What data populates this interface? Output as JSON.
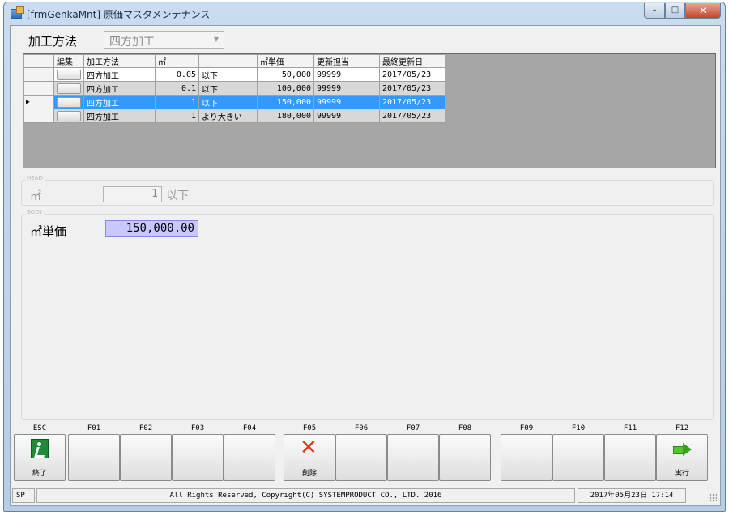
{
  "window": {
    "title": "[frmGenkaMnt] 原価マスタメンテナンス",
    "controls": {
      "minimize": "–",
      "maximize": "□",
      "close": "✕"
    }
  },
  "filter": {
    "label": "加工方法",
    "value": "四方加工"
  },
  "grid": {
    "columns": [
      "",
      "編集",
      "加工方法",
      "㎡",
      "",
      "㎡単価",
      "更新担当",
      "最終更新日"
    ],
    "rows": [
      {
        "method": "四方加工",
        "m2": "0.05",
        "cond": "以下",
        "unit_price": "50,000",
        "updater": "99999",
        "updated": "2017/05/23",
        "style": "white",
        "selected": false
      },
      {
        "method": "四方加工",
        "m2": "0.1",
        "cond": "以下",
        "unit_price": "100,000",
        "updater": "99999",
        "updated": "2017/05/23",
        "style": "gray",
        "selected": false
      },
      {
        "method": "四方加工",
        "m2": "1",
        "cond": "以下",
        "unit_price": "150,000",
        "updater": "99999",
        "updated": "2017/05/23",
        "style": "sel",
        "selected": true
      },
      {
        "method": "四方加工",
        "m2": "1",
        "cond": "より大きい",
        "unit_price": "180,000",
        "updater": "99999",
        "updated": "2017/05/23",
        "style": "gray",
        "selected": false
      }
    ],
    "current_row_marker": "▶"
  },
  "head": {
    "group_title": "HEAD",
    "m2_label": "㎡",
    "m2_value": "1",
    "m2_unit": "以下"
  },
  "body": {
    "group_title": "BODY",
    "unit_price_label": "㎡単価",
    "unit_price_value": "150,000.00"
  },
  "fkeys": [
    {
      "key": "ESC",
      "caption": "終了",
      "icon": "exit-icon"
    },
    {
      "key": "F01",
      "caption": ""
    },
    {
      "key": "F02",
      "caption": ""
    },
    {
      "key": "F03",
      "caption": ""
    },
    {
      "key": "F04",
      "caption": ""
    },
    {
      "key": "F05",
      "caption": "削除",
      "icon": "delete-icon"
    },
    {
      "key": "F06",
      "caption": ""
    },
    {
      "key": "F07",
      "caption": ""
    },
    {
      "key": "F08",
      "caption": ""
    },
    {
      "key": "F09",
      "caption": ""
    },
    {
      "key": "F10",
      "caption": ""
    },
    {
      "key": "F11",
      "caption": ""
    },
    {
      "key": "F12",
      "caption": "実行",
      "icon": "run-icon"
    }
  ],
  "status": {
    "mode": "SP",
    "copyright": "All Rights Reserved, Copyright(C) SYSTEMPRODUCT CO., LTD. 2016",
    "datetime": "2017年05月23日 17:14"
  },
  "colors": {
    "selection": "#3399ff",
    "input_highlight": "#c8c8ff",
    "grid_background": "#a6a6a6"
  }
}
